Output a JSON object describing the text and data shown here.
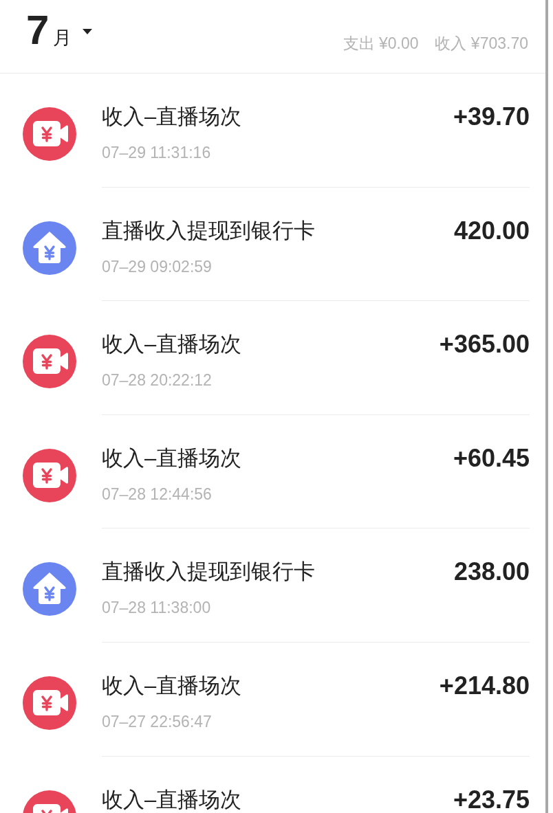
{
  "header": {
    "month": "7",
    "month_unit": "月",
    "totals": [
      {
        "label": "支出",
        "amount": "¥0.00"
      },
      {
        "label": "收入",
        "amount": "¥703.70"
      }
    ]
  },
  "transactions": [
    {
      "kind": "live-income",
      "title": "收入–直播场次",
      "date": "07–29 11:31:16",
      "amount": "+39.70"
    },
    {
      "kind": "withdrawal",
      "title": "直播收入提现到银行卡",
      "date": "07–29 09:02:59",
      "amount": "420.00"
    },
    {
      "kind": "live-income",
      "title": "收入–直播场次",
      "date": "07–28 20:22:12",
      "amount": "+365.00"
    },
    {
      "kind": "live-income",
      "title": "收入–直播场次",
      "date": "07–28 12:44:56",
      "amount": "+60.45"
    },
    {
      "kind": "withdrawal",
      "title": "直播收入提现到银行卡",
      "date": "07–28 11:38:00",
      "amount": "238.00"
    },
    {
      "kind": "live-income",
      "title": "收入–直播场次",
      "date": "07–27 22:56:47",
      "amount": "+214.80"
    },
    {
      "kind": "live-income",
      "title": "收入–直播场次",
      "amount": "+23.75"
    }
  ]
}
